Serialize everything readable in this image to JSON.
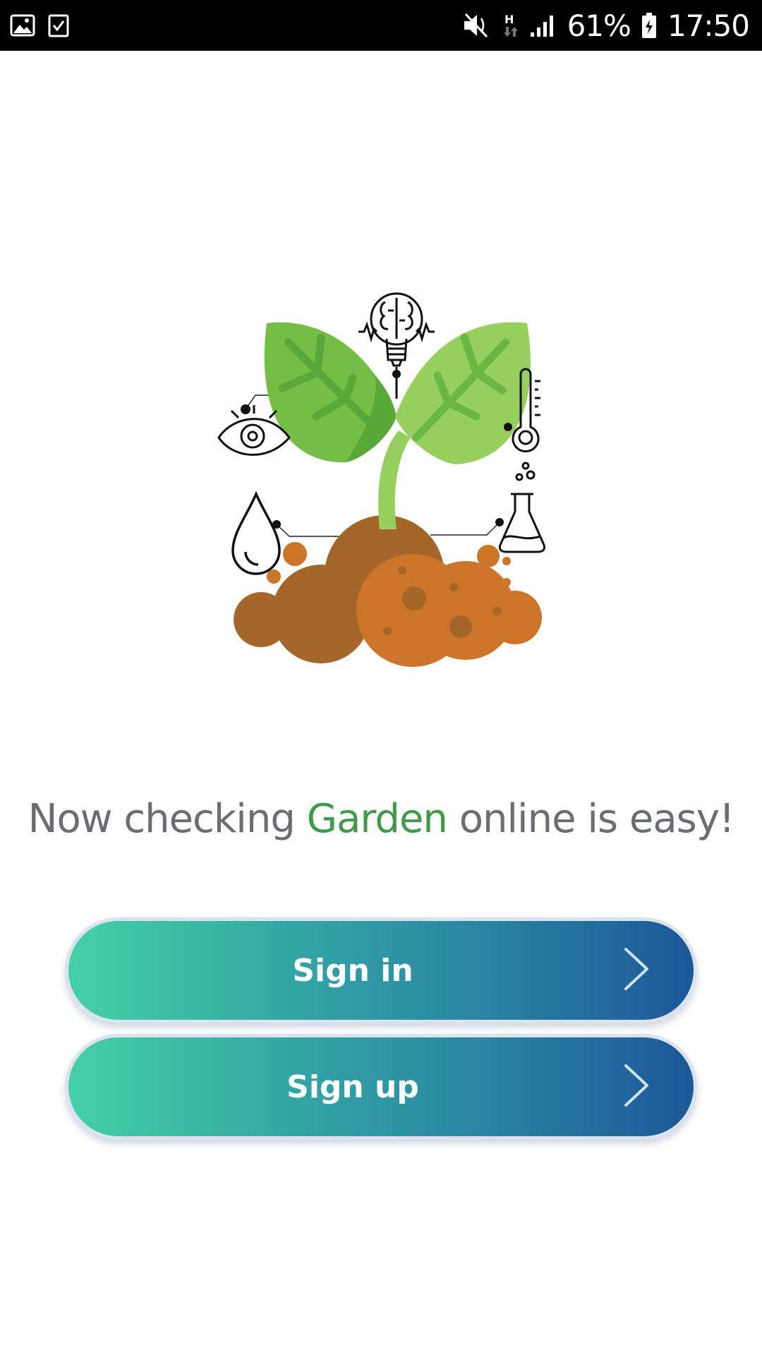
{
  "status_bar": {
    "battery_percent": "61%",
    "time": "17:50",
    "network_type": "H",
    "icons": [
      "gallery-icon",
      "checklist-icon",
      "mute-icon",
      "network-h-icon",
      "signal-icon",
      "battery-icon"
    ]
  },
  "illustration": {
    "icons": [
      "brain-bulb-icon",
      "eye-icon",
      "thermometer-icon",
      "flask-icon",
      "water-drop-icon",
      "plant-sprout-icon",
      "soil-icon"
    ]
  },
  "tagline": {
    "before": "Now checking ",
    "brand": "Garden",
    "after": " online is easy!"
  },
  "buttons": {
    "sign_in": "Sign in",
    "sign_up": "Sign up"
  },
  "colors": {
    "brand_green": "#3f9a4a",
    "gradient_start": "#45d0a6",
    "gradient_end": "#1d5799",
    "tagline_gray": "#6b6d74"
  }
}
